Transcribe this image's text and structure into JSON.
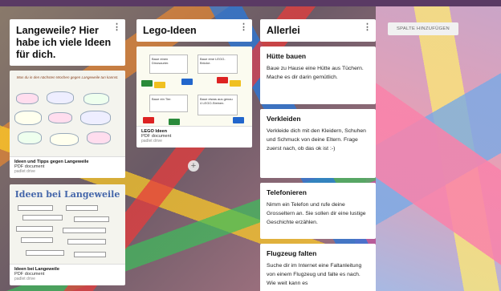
{
  "header_color": "#5a3a64",
  "add_column_label": "SPALTE HINZUFÜGEN",
  "columns": [
    {
      "title": "Langeweile? Hier habe ich viele Ideen für dich.",
      "attachments": [
        {
          "name": "Ideen und Tipps gegen Langeweile",
          "type": "PDF document",
          "source": "padlet drive",
          "thumb_heading": "Was du in den nächsten Wochen gegen Langeweile tun kannst."
        },
        {
          "name": "Ideen bei Langeweile",
          "type": "PDF document",
          "source": "padlet drive",
          "thumb_heading": "Ideen bei Langeweile"
        }
      ]
    },
    {
      "title": "Lego-Ideen",
      "attachments": [
        {
          "name": "LEGO Ideen",
          "type": "PDF document",
          "source": "padlet drive",
          "thumb_labels": [
            "Baue einen Dinosaurier.",
            "Baue eine LEGO-Brücke.",
            "Baue ein Tier.",
            "Baue etwas aus genau 4 LEGO-Steinen."
          ]
        }
      ]
    },
    {
      "title": "Allerlei",
      "cards": [
        {
          "title": "Hütte bauen",
          "body": "Baue zu Hause eine Hütte aus Tüchern. Mache es dir darin gemütlich."
        },
        {
          "title": "Verkleiden",
          "body": "Verkleide dich mit den Kleidern, Schuhen und Schmuck von deine Eltern. Frage zuerst nach, ob das ok ist :-)"
        },
        {
          "title": "Telefonieren",
          "body": "Nimm ein Telefon und rufe deine Grosseltern an. Sie sollen dir eine lustige Geschichte erzählen."
        },
        {
          "title": "Flugzeug falten",
          "body": "Suche dir im Internet eine Faltanleitung von einem Flugzeug und falte es nach. Wie weit kann es"
        }
      ]
    }
  ],
  "menu_icon": "more-vertical-icon",
  "plus_icon": "plus-icon"
}
